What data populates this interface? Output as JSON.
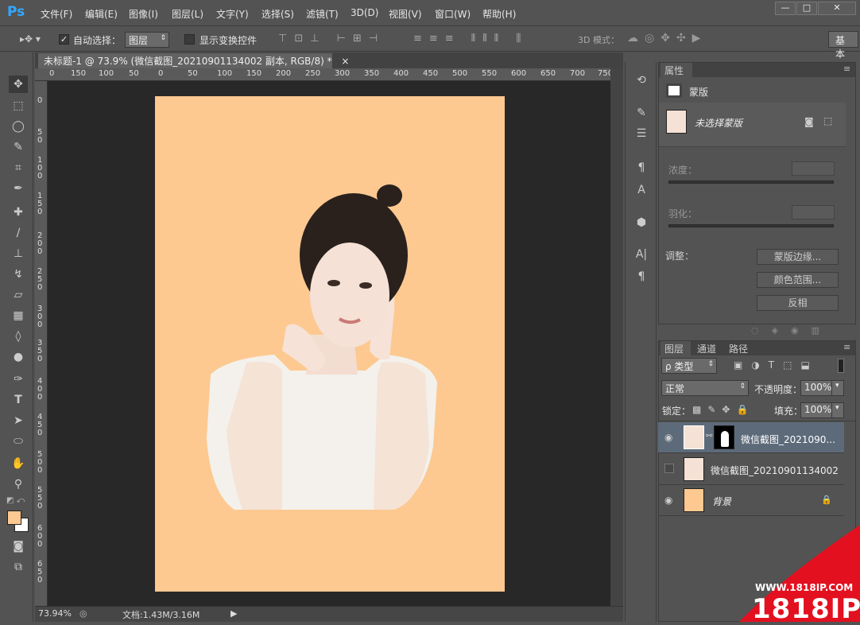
{
  "app": {
    "logo": "Ps"
  },
  "menu": [
    "文件(F)",
    "编辑(E)",
    "图像(I)",
    "图层(L)",
    "文字(Y)",
    "选择(S)",
    "滤镜(T)",
    "3D(D)",
    "视图(V)",
    "窗口(W)",
    "帮助(H)"
  ],
  "window_controls": [
    "—",
    "□",
    "✕"
  ],
  "options_bar": {
    "auto_select_label": "自动选择：",
    "auto_select_value": "图层",
    "show_transform_label": "显示变换控件",
    "mode_3d_label": "3D 模式：",
    "workspace_label": "基本"
  },
  "document": {
    "tab_title": "未标题-1 @ 73.9% (微信截图_20210901134002 副本, RGB/8) *",
    "close": "×",
    "ruler_top": [
      "0",
      "150",
      "100",
      "50",
      "0",
      "50",
      "100",
      "150",
      "200",
      "250",
      "300",
      "350",
      "400",
      "450",
      "500",
      "550",
      "600",
      "650",
      "700",
      "750"
    ],
    "ruler_left": [
      "0",
      "50",
      "100",
      "150",
      "200",
      "250",
      "300",
      "350",
      "400",
      "450",
      "500",
      "550",
      "600",
      "650"
    ],
    "zoom": "73.94%",
    "doc_info": "文档:1.43M/3.16M",
    "canvas_color": "#fdc991"
  },
  "properties": {
    "tab": "属性",
    "title": "蒙版",
    "mask_state": "未选择蒙版",
    "density_label": "浓度：",
    "feather_label": "羽化：",
    "adjust_label": "调整：",
    "buttons": [
      "蒙版边缘...",
      "颜色范围...",
      "反相"
    ]
  },
  "layers_panel": {
    "tabs": [
      "图层",
      "通道",
      "路径"
    ],
    "filter_label": "ρ 类型",
    "blend_mode": "正常",
    "opacity_label": "不透明度：",
    "opacity_value": "100%",
    "lock_label": "锁定：",
    "fill_label": "填充：",
    "fill_value": "100%",
    "layers": [
      {
        "name": "微信截图_2021090...",
        "visible": true,
        "selected": true
      },
      {
        "name": "微信截图_20210901134002",
        "visible": false,
        "selected": false
      },
      {
        "name": "背景",
        "visible": true,
        "selected": false
      }
    ]
  },
  "watermark": {
    "url": "WWW.1818IP.COM",
    "brand": "1818IP"
  }
}
